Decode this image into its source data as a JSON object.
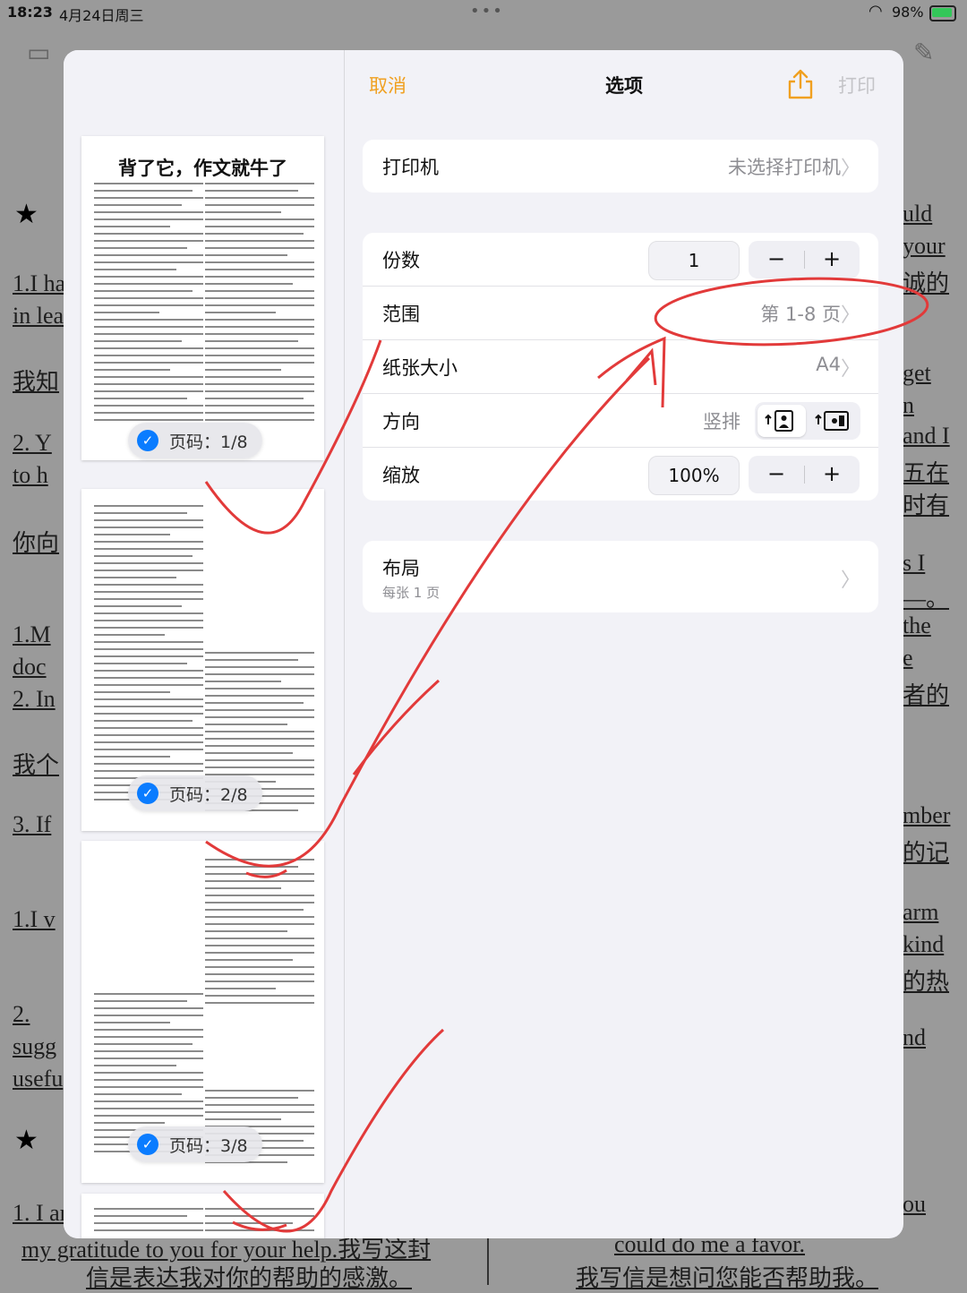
{
  "status_bar": {
    "time": "18:23",
    "date": "4月24日周三",
    "battery": "98%"
  },
  "background": {
    "left_fragments": [
      "1.I ha",
      "in lea",
      "我知",
      "2. Y",
      "to h",
      "你向",
      "1.M",
      "doc",
      "2. In",
      "我个",
      "3. If",
      "1.I v",
      "2.",
      "sugg",
      "usefu",
      "1. I ar"
    ],
    "right_fragments": [
      "uld",
      "your",
      "诚的",
      "get",
      "n",
      "and I",
      "五在",
      "时有",
      "s I",
      "—。",
      "the",
      "e",
      "者的",
      "mber",
      "的记",
      "arm",
      "kind",
      "的热",
      "nd",
      "ou"
    ],
    "bottom_left_en": "my gratitude to you for your help.我写这封",
    "bottom_left_zh": "信是表达我对你的帮助的感激。",
    "bottom_right_en": "could do me a favor.",
    "bottom_right_zh": "我写信是想问您能否帮助我。"
  },
  "preview": {
    "page1_title": "背了它，作文就牛了",
    "pages": [
      {
        "badge": "页码：1/8"
      },
      {
        "badge": "页码：2/8"
      },
      {
        "badge": "页码：3/8"
      }
    ]
  },
  "nav": {
    "cancel": "取消",
    "title": "选项",
    "print": "打印"
  },
  "printer": {
    "label": "打印机",
    "value": "未选择打印机"
  },
  "copies": {
    "label": "份数",
    "value": "1",
    "minus": "−",
    "plus": "+"
  },
  "range": {
    "label": "范围",
    "value": "第 1-8 页"
  },
  "paper": {
    "label": "纸张大小",
    "value": "A4"
  },
  "orientation": {
    "label": "方向",
    "value": "竖排"
  },
  "scale": {
    "label": "缩放",
    "value": "100%",
    "minus": "−",
    "plus": "+"
  },
  "layout": {
    "label": "布局",
    "sub": "每张 1 页"
  }
}
